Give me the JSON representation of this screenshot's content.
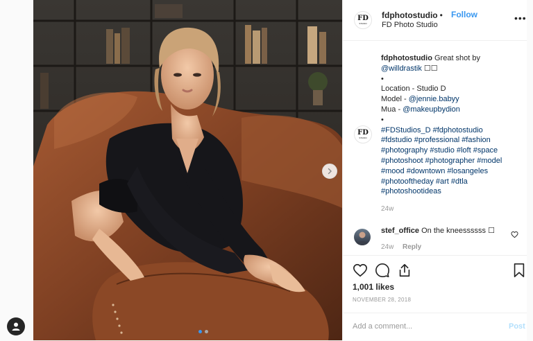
{
  "post": {
    "username": "fdphotostudio",
    "separator": "•",
    "follow_label": "Follow",
    "full_name": "FD Photo Studio",
    "more_label": "•••",
    "logo_text": "FD",
    "logo_subtext": "STUDIO"
  },
  "caption": {
    "username": "fdphotostudio",
    "line1_text": "Great shot by",
    "mention_photographer": "@willdrastik",
    "emoji_boxes": "☐☐",
    "bullet": "•",
    "location": "Location - Studio D",
    "model_prefix": "Model - ",
    "model_mention": "@jennie.babyy",
    "mua_prefix": "Mua - ",
    "mua_mention": "@makeupbydion",
    "hashtag_lines": [
      "#FDStudios_D #fdphotostudio",
      "#fdstudio #professional #fashion",
      "#photography #studio #loft #space",
      "#photoshoot #photographer #model",
      "#mood #downtown #losangeles",
      "#photooftheday #art #dtla",
      "#photoshootideas"
    ],
    "time": "24w"
  },
  "comment": {
    "username": "stef_office",
    "text": "On the kneessssss ☐",
    "time": "24w",
    "reply_label": "Reply"
  },
  "engagement": {
    "likes": "1,001 likes",
    "date": "NOVEMBER 28, 2018"
  },
  "add_comment": {
    "placeholder": "Add a comment...",
    "post_label": "Post"
  },
  "carousel": {
    "slide_count": 2,
    "active_slide": 1
  },
  "colors": {
    "link_blue": "#3897f0",
    "post_disabled": "#b2dffc",
    "muted_gray": "#999999",
    "text_dark": "#262626"
  },
  "icons": [
    "user-icon",
    "chevron-right-icon",
    "heart-icon",
    "comment-icon",
    "share-icon",
    "bookmark-icon",
    "more-icon"
  ]
}
